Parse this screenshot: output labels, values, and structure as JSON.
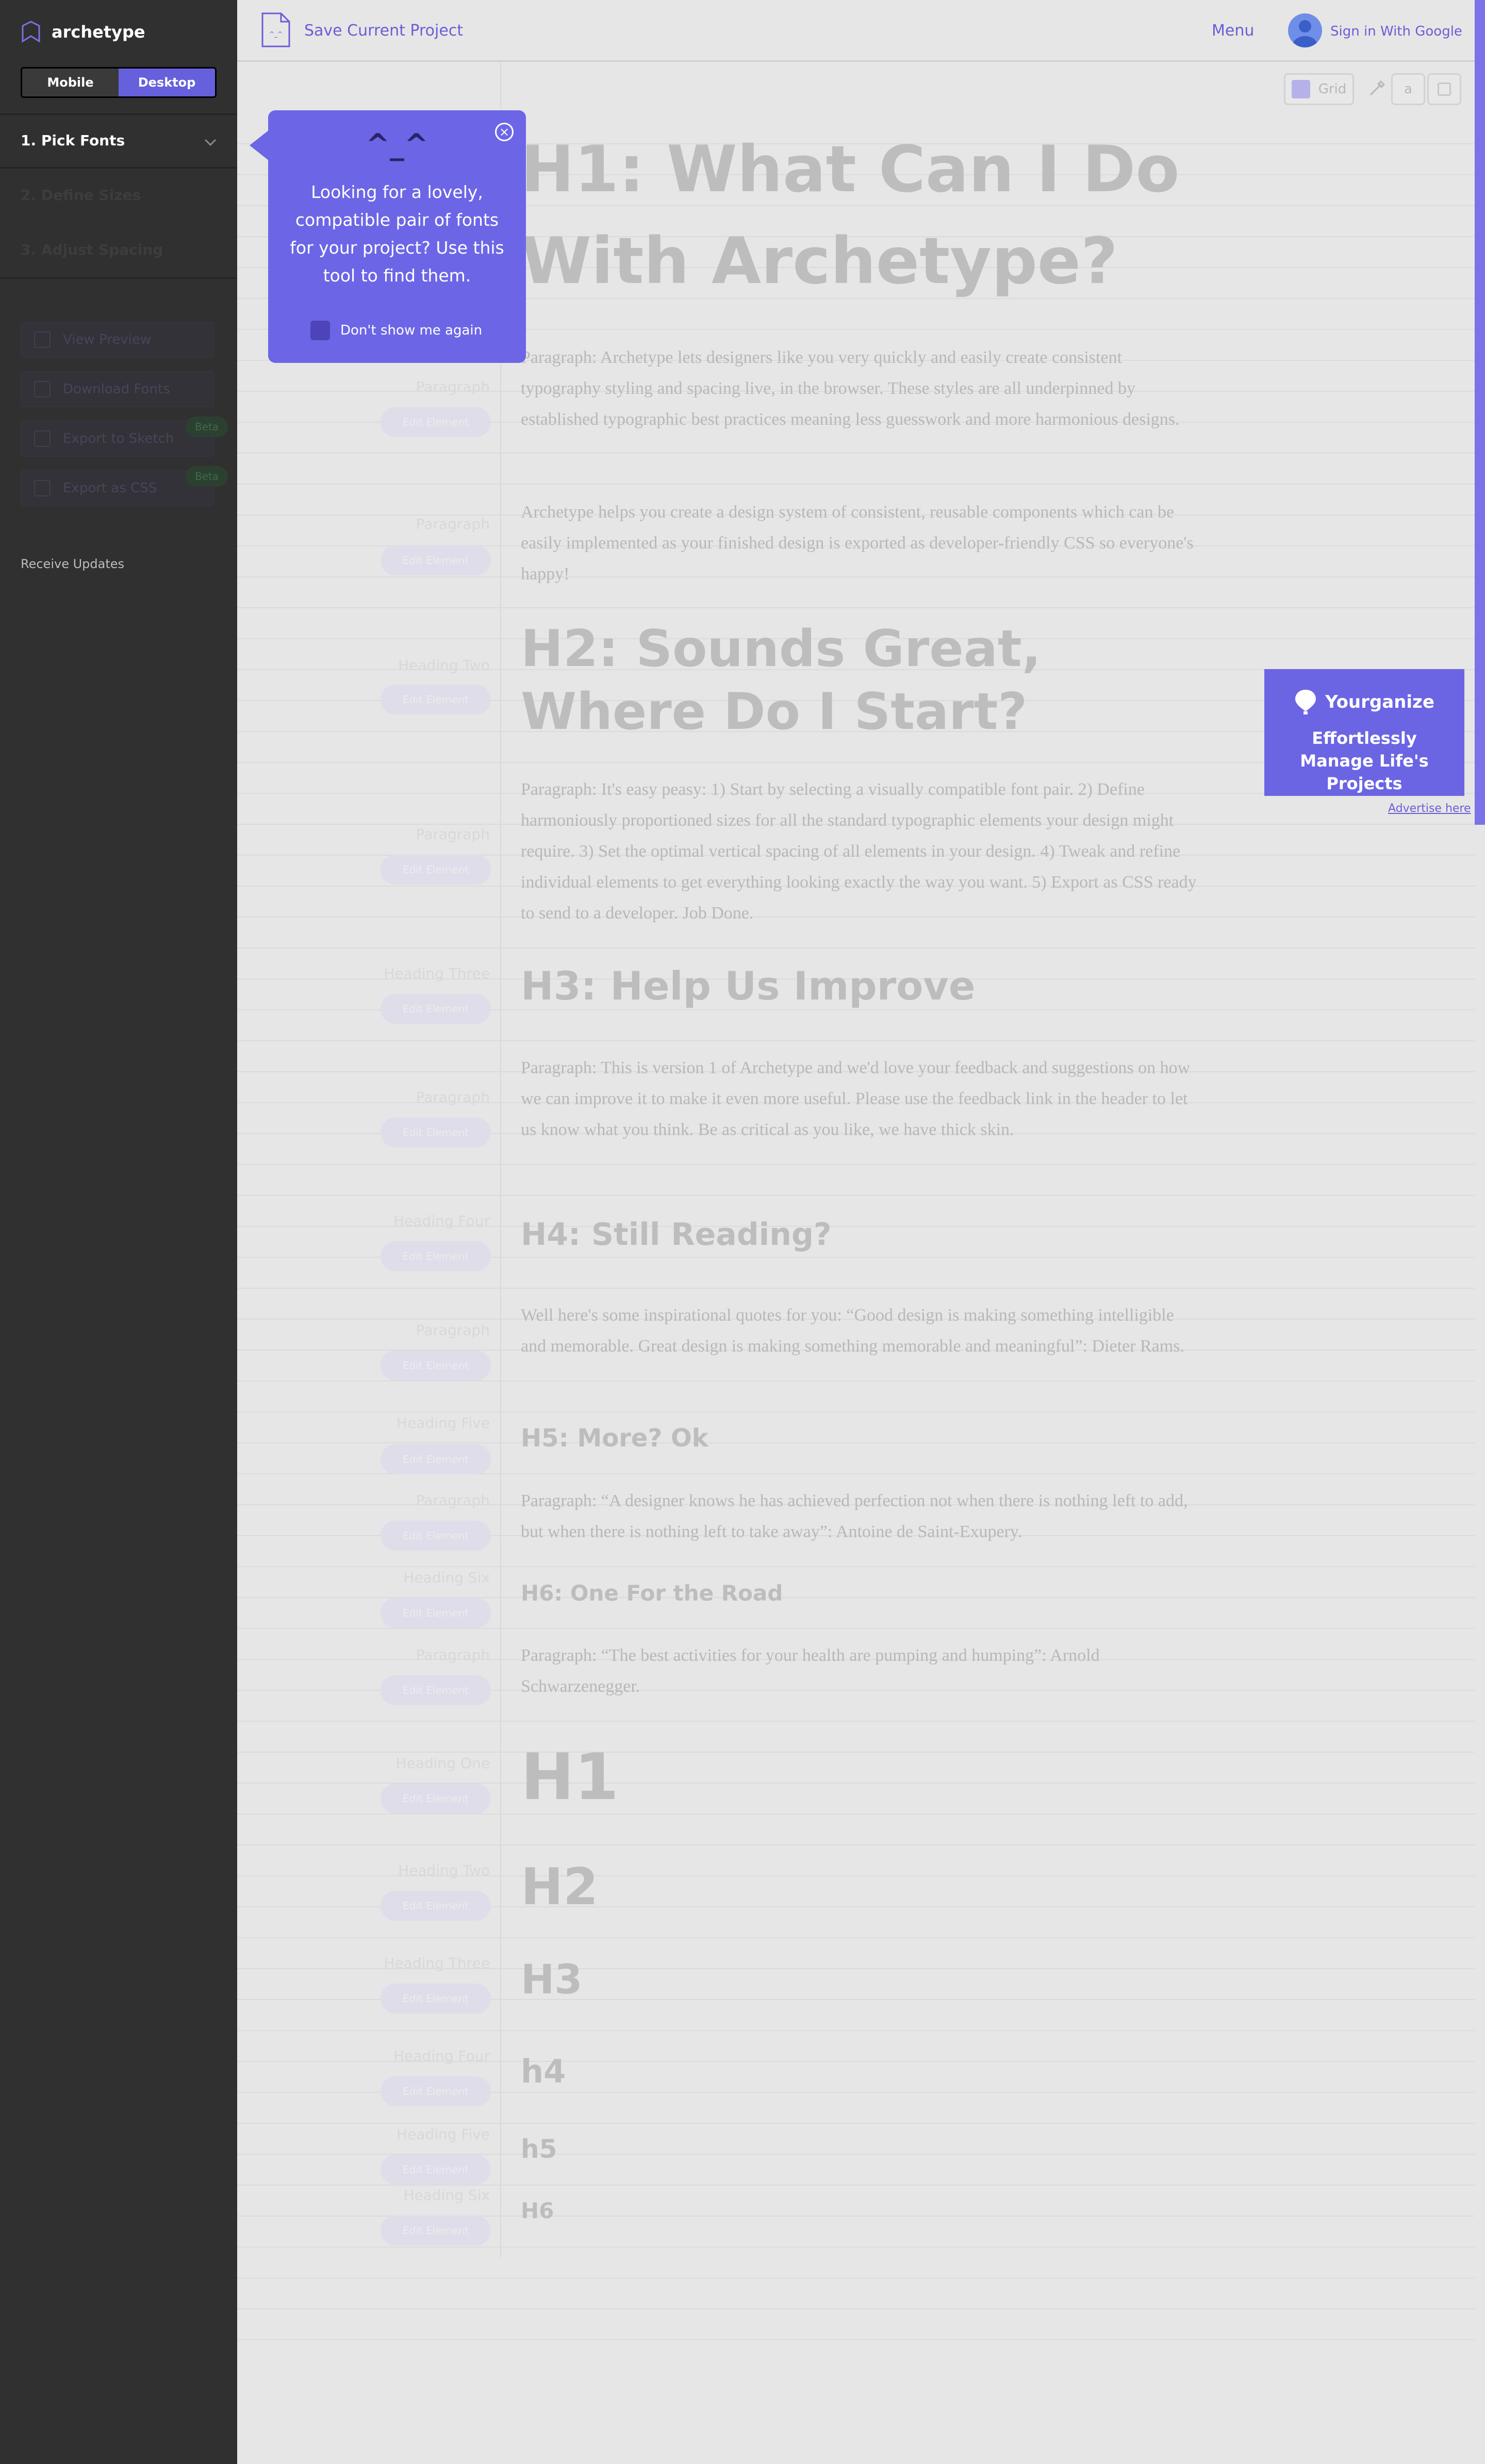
{
  "brand": {
    "name": "archetype"
  },
  "device_toggle": {
    "mobile": "Mobile",
    "desktop": "Desktop",
    "selected": "Desktop"
  },
  "steps": [
    {
      "label": "1. Pick Fonts"
    },
    {
      "label": "2. Define Sizes"
    },
    {
      "label": "3. Adjust Spacing"
    }
  ],
  "actions": [
    {
      "label": "View Preview"
    },
    {
      "label": "Download Fonts"
    },
    {
      "label": "Export to Sketch",
      "badge": "Beta"
    },
    {
      "label": "Export as CSS",
      "badge": "Beta"
    }
  ],
  "receive_updates": "Receive Updates",
  "topbar": {
    "save_label": "Save Current Project",
    "menu_label": "Menu",
    "signin_label": "Sign in With Google"
  },
  "tools": {
    "grid_label": "Grid",
    "glyph": "a"
  },
  "tooltip": {
    "face": "^_^",
    "text": "Looking for a lovely, compatible pair of fonts for your project? Use this tool to find them.",
    "dont_show": "Don't show me again"
  },
  "ad": {
    "brand": "Yourganize",
    "text": "Effortlessly Manage Life's Projects",
    "link": "Advertise here"
  },
  "rows": [
    {
      "label": "",
      "pill": "",
      "text": "H1: What Can I Do With Archetype?"
    },
    {
      "label": "Paragraph",
      "pill": "Edit Element",
      "text": "Paragraph: Archetype lets designers like you very quickly and easily create consistent typography styling and spacing live, in the browser. These styles are all underpinned by established typographic best practices meaning less guesswork and more harmonious designs."
    },
    {
      "label": "Paragraph",
      "pill": "Edit Element",
      "text": "Archetype helps you create a design system of consistent, reusable components which can be easily implemented as your finished design is exported as developer-friendly CSS so everyone's happy!"
    },
    {
      "label": "Heading Two",
      "pill": "Edit Element",
      "text": "H2: Sounds Great, Where Do I Start?"
    },
    {
      "label": "Paragraph",
      "pill": "Edit Element",
      "text": "Paragraph: It's easy peasy: 1) Start by selecting a visually compatible font pair. 2) Define harmoniously proportioned sizes for all the standard typographic elements your design might require. 3) Set the optimal vertical spacing of all elements in your design. 4) Tweak and refine individual elements to get everything looking exactly the way you want. 5) Export as CSS ready to send to a developer. Job Done."
    },
    {
      "label": "Heading Three",
      "pill": "Edit Element",
      "text": "H3: Help Us Improve"
    },
    {
      "label": "Paragraph",
      "pill": "Edit Element",
      "text": "Paragraph: This is version 1 of Archetype and we'd love your feedback and suggestions on how we can improve it to make it even more useful. Please use the feedback link in the header to let us know what you think. Be as critical as you like, we have thick skin."
    },
    {
      "label": "Heading Four",
      "pill": "Edit Element",
      "text": "H4: Still Reading?"
    },
    {
      "label": "Paragraph",
      "pill": "Edit Element",
      "text": "Well here's some inspirational quotes for you: “Good design is making something intelligible and memorable. Great design is making something memorable and meaningful”: Dieter Rams."
    },
    {
      "label": "Heading Five",
      "pill": "Edit Element",
      "text": "H5: More? Ok"
    },
    {
      "label": "Paragraph",
      "pill": "Edit Element",
      "text": "Paragraph: “A designer knows he has achieved perfection not when there is nothing left to add, but when there is nothing left to take away”: Antoine de Saint-Exupery."
    },
    {
      "label": "Heading Six",
      "pill": "Edit Element",
      "text": "H6: One For the Road"
    },
    {
      "label": "Paragraph",
      "pill": "Edit Element",
      "text": "Paragraph: “The best activities for your health are pumping and humping”: Arnold Schwarzenegger."
    },
    {
      "label": "Heading One",
      "pill": "Edit Element",
      "text": "H1"
    },
    {
      "label": "Heading Two",
      "pill": "Edit Element",
      "text": "H2"
    },
    {
      "label": "Heading Three",
      "pill": "Edit Element",
      "text": "H3"
    },
    {
      "label": "Heading Four",
      "pill": "Edit Element",
      "text": "h4"
    },
    {
      "label": "Heading Five",
      "pill": "Edit Element",
      "text": "h5"
    },
    {
      "label": "Heading Six",
      "pill": "Edit Element",
      "text": "H6"
    }
  ]
}
